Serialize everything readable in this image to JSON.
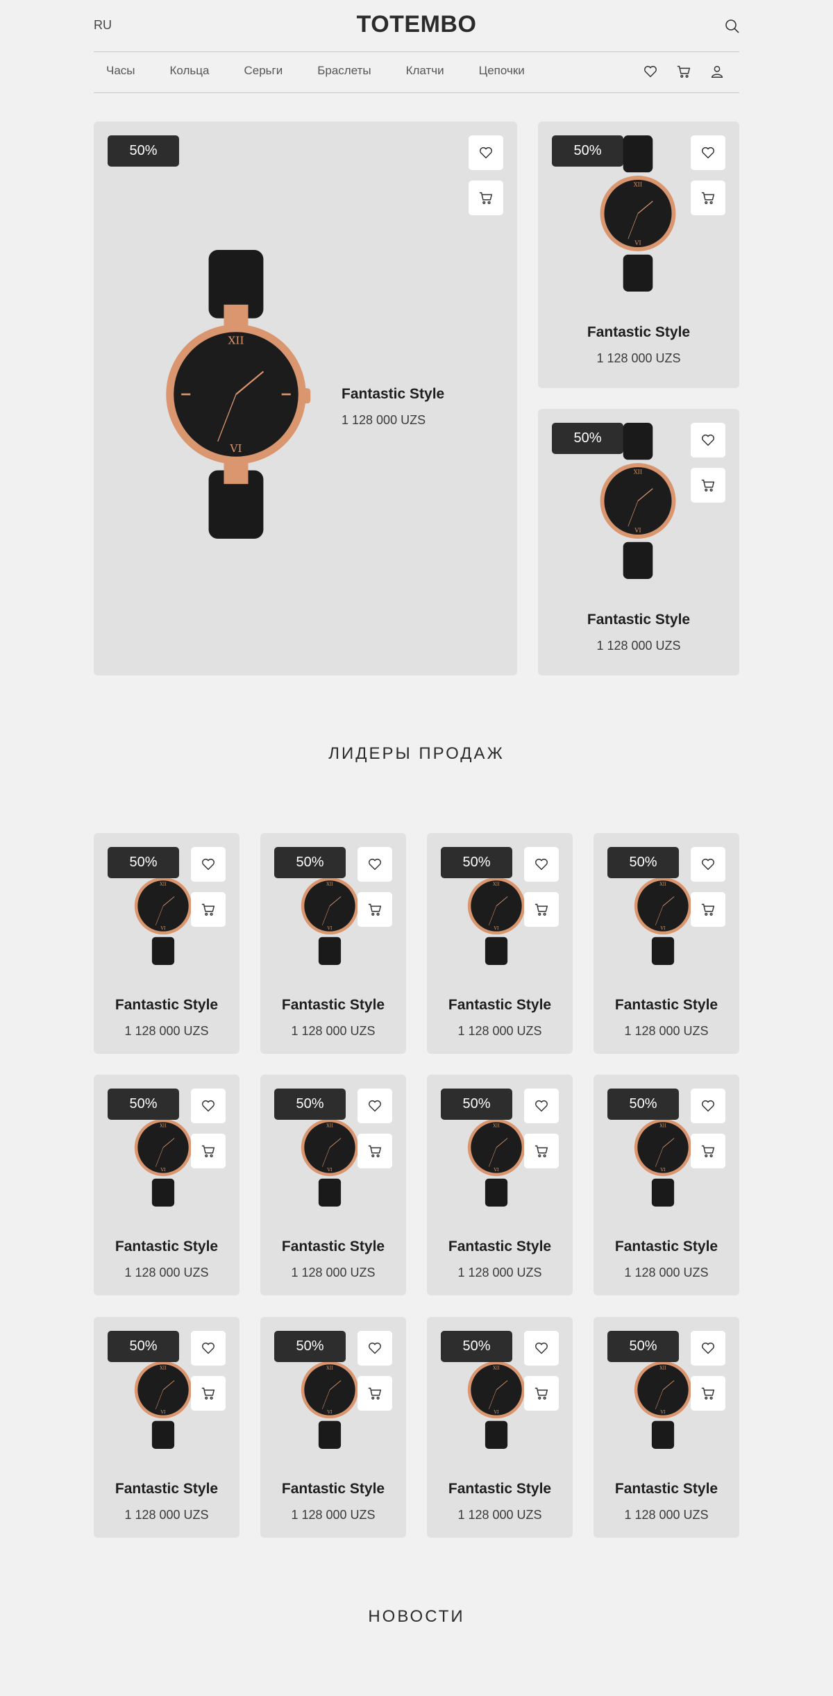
{
  "header": {
    "lang": "RU",
    "logo": "TOTEMBO",
    "nav": [
      "Часы",
      "Кольца",
      "Серьги",
      "Браслеты",
      "Клатчи",
      "Цепочки"
    ]
  },
  "featured": {
    "main": {
      "badge": "50%",
      "title": "Fantastic Style",
      "price": "1 128 000 UZS"
    },
    "side": [
      {
        "badge": "50%",
        "title": "Fantastic Style",
        "price": "1 128 000 UZS"
      },
      {
        "badge": "50%",
        "title": "Fantastic Style",
        "price": "1 128 000 UZS"
      }
    ]
  },
  "bestsellers": {
    "title": "ЛИДЕРЫ ПРОДАЖ",
    "items": [
      {
        "badge": "50%",
        "title": "Fantastic Style",
        "price": "1 128 000 UZS"
      },
      {
        "badge": "50%",
        "title": "Fantastic Style",
        "price": "1 128 000 UZS"
      },
      {
        "badge": "50%",
        "title": "Fantastic Style",
        "price": "1 128 000 UZS"
      },
      {
        "badge": "50%",
        "title": "Fantastic Style",
        "price": "1 128 000 UZS"
      },
      {
        "badge": "50%",
        "title": "Fantastic Style",
        "price": "1 128 000 UZS"
      },
      {
        "badge": "50%",
        "title": "Fantastic Style",
        "price": "1 128 000 UZS"
      },
      {
        "badge": "50%",
        "title": "Fantastic Style",
        "price": "1 128 000 UZS"
      },
      {
        "badge": "50%",
        "title": "Fantastic Style",
        "price": "1 128 000 UZS"
      },
      {
        "badge": "50%",
        "title": "Fantastic Style",
        "price": "1 128 000 UZS"
      },
      {
        "badge": "50%",
        "title": "Fantastic Style",
        "price": "1 128 000 UZS"
      },
      {
        "badge": "50%",
        "title": "Fantastic Style",
        "price": "1 128 000 UZS"
      },
      {
        "badge": "50%",
        "title": "Fantastic Style",
        "price": "1 128 000 UZS"
      }
    ]
  },
  "news": {
    "title": "НОВОСТИ"
  },
  "icons": {
    "search": "search-icon",
    "heart": "heart-icon",
    "cart": "cart-icon",
    "user": "user-icon"
  },
  "colors": {
    "background": "#f1f1f1",
    "card": "#e1e1e1",
    "badge": "#2d2d2d",
    "watch_dial": "#1c1c1c",
    "watch_gold": "#d9966f"
  }
}
